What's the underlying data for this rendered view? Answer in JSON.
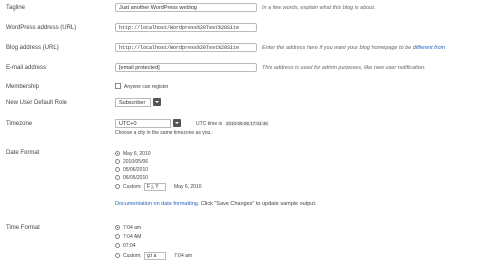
{
  "tagline": {
    "label": "Tagline",
    "value": "Just another WordPress weblog",
    "description": "In a few words, explain what this blog is about."
  },
  "wp_address": {
    "label": "WordPress address (URL)",
    "value": "http://localhost/Wordpress%20Test%20Site"
  },
  "blog_address": {
    "label": "Blog address (URL)",
    "value": "http://localhost/Wordpress%20Test%20Site",
    "description": "Enter the address here if you want your blog homepage to be ",
    "description_link": "different from"
  },
  "email": {
    "label": "E-mail address",
    "value": "[email protected]",
    "description": "This address is used for admin purposes, like new user notification."
  },
  "membership": {
    "label": "Membership",
    "checkbox_label": "Anyone can register"
  },
  "default_role": {
    "label": "New User Default Role",
    "value": "Subscriber"
  },
  "timezone": {
    "label": "Timezone",
    "value": "UTC+0",
    "utc_label": "UTC time is",
    "utc_value": "2010-05-06 17:04:46",
    "help": "Choose a city in the same timezone as you."
  },
  "date_format": {
    "label": "Date Format",
    "options": [
      "May 6, 2010",
      "2010/05/06",
      "05/06/2010",
      "06/05/2010"
    ],
    "custom_label": "Custom:",
    "custom_value": "F j, Y",
    "custom_preview": "May 6, 2010",
    "doc_link": "Documentation on date formatting",
    "doc_after": ". Click \"Save Changes\" to update sample output."
  },
  "time_format": {
    "label": "Time Format",
    "options": [
      "7:04 am",
      "7:04 AM",
      "07:04"
    ],
    "custom_label": "Custom:",
    "custom_value": "g:i a",
    "custom_preview": "7:04 am"
  }
}
